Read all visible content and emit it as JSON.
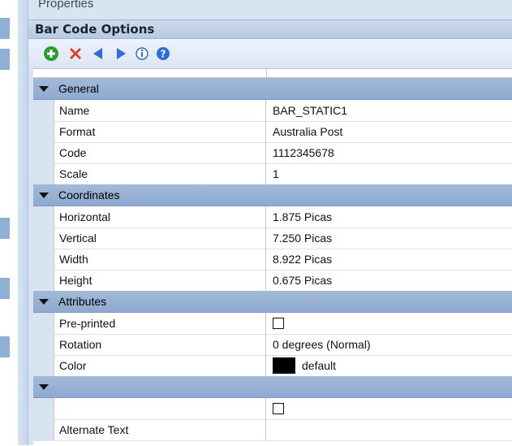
{
  "panel": {
    "properties_title": "Properties",
    "header_title": "Bar Code Options"
  },
  "toolbar": {
    "buttons": [
      {
        "name": "add-icon",
        "color": "#2e9b2e"
      },
      {
        "name": "delete-icon",
        "color": "#e2401c"
      },
      {
        "name": "previous-arrow-icon",
        "color": "#2a6fd8"
      },
      {
        "name": "next-arrow-icon",
        "color": "#2a6fd8"
      },
      {
        "name": "info-icon",
        "color": "#2a6fd8"
      },
      {
        "name": "help-icon",
        "color": "#2a6fd8"
      }
    ]
  },
  "categories": {
    "general": "General",
    "coordinates": "Coordinates",
    "attributes": "Attributes",
    "unnamed": ""
  },
  "general": {
    "name": {
      "label": "Name",
      "value": "BAR_STATIC1"
    },
    "format": {
      "label": "Format",
      "value": "Australia Post"
    },
    "code": {
      "label": "Code",
      "value": "1112345678"
    },
    "scale": {
      "label": "Scale",
      "value": "1"
    }
  },
  "coordinates": {
    "horizontal": {
      "label": "Horizontal",
      "value": "1.875 Picas"
    },
    "vertical": {
      "label": "Vertical",
      "value": "7.250 Picas"
    },
    "width": {
      "label": "Width",
      "value": "8.922 Picas"
    },
    "height": {
      "label": "Height",
      "value": "0.675 Picas"
    }
  },
  "attributes": {
    "preprinted": {
      "label": "Pre-printed",
      "checked": false
    },
    "rotation": {
      "label": "Rotation",
      "value": "0 degrees (Normal)"
    },
    "color": {
      "label": "Color",
      "value": "default",
      "swatch": "#000000"
    }
  },
  "extra": {
    "checkbox_row": {
      "label": "",
      "checked": false
    },
    "alternate_text": {
      "label": "Alternate Text",
      "value": ""
    }
  }
}
